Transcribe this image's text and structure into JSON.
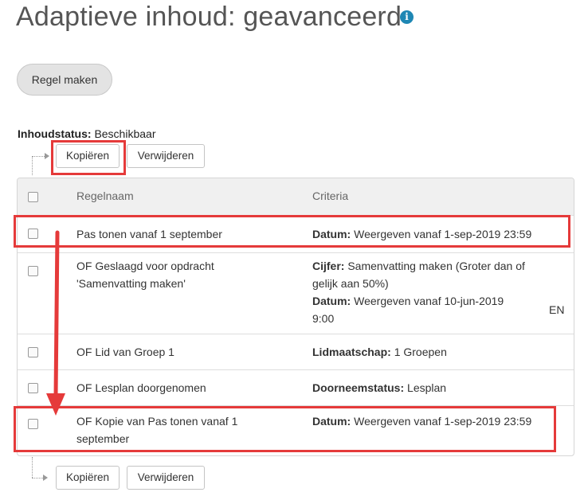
{
  "page": {
    "title": "Adaptieve inhoud: geavanceerd",
    "info_icon": "info-circle-icon",
    "create_rule_button": "Regel maken"
  },
  "status": {
    "label": "Inhoudstatus:",
    "value": "Beschikbaar"
  },
  "toolbar_top": {
    "copy": "Kopiëren",
    "delete": "Verwijderen"
  },
  "table": {
    "headers": {
      "name": "Regelnaam",
      "criteria": "Criteria"
    },
    "rows": [
      {
        "name": "Pas tonen vanaf 1 september",
        "criteria": [
          {
            "label": "Datum:",
            "value": " Weergeven vanaf 1-sep-2019 23:59"
          }
        ]
      },
      {
        "name_line1": "OF Geslaagd voor opdracht",
        "name_line2": "'Samenvatting maken'",
        "criteria": [
          {
            "label": "Cijfer:",
            "value": " Samenvatting maken (Groter dan of"
          },
          {
            "label": "",
            "value": "gelijk aan 50%)"
          },
          {
            "label": "Datum:",
            "value": " Weergeven vanaf 10-jun-2019"
          },
          {
            "label": "",
            "value": "9:00"
          }
        ],
        "logic": "EN"
      },
      {
        "name": "OF Lid van Groep 1",
        "criteria": [
          {
            "label": "Lidmaatschap:",
            "value": " 1 Groepen"
          }
        ]
      },
      {
        "name": "OF Lesplan doorgenomen",
        "criteria": [
          {
            "label": "Doorneemstatus:",
            "value": " Lesplan"
          }
        ]
      },
      {
        "name_line1": "OF Kopie van Pas tonen vanaf 1",
        "name_line2": "september",
        "criteria": [
          {
            "label": "Datum:",
            "value": " Weergeven vanaf 1-sep-2019 23:59"
          }
        ]
      }
    ]
  },
  "toolbar_bottom": {
    "copy": "Kopiëren",
    "delete": "Verwijderen"
  },
  "colors": {
    "highlight": "#e53a3a",
    "info": "#1e87b4",
    "header_bg": "#f0f0f0"
  }
}
